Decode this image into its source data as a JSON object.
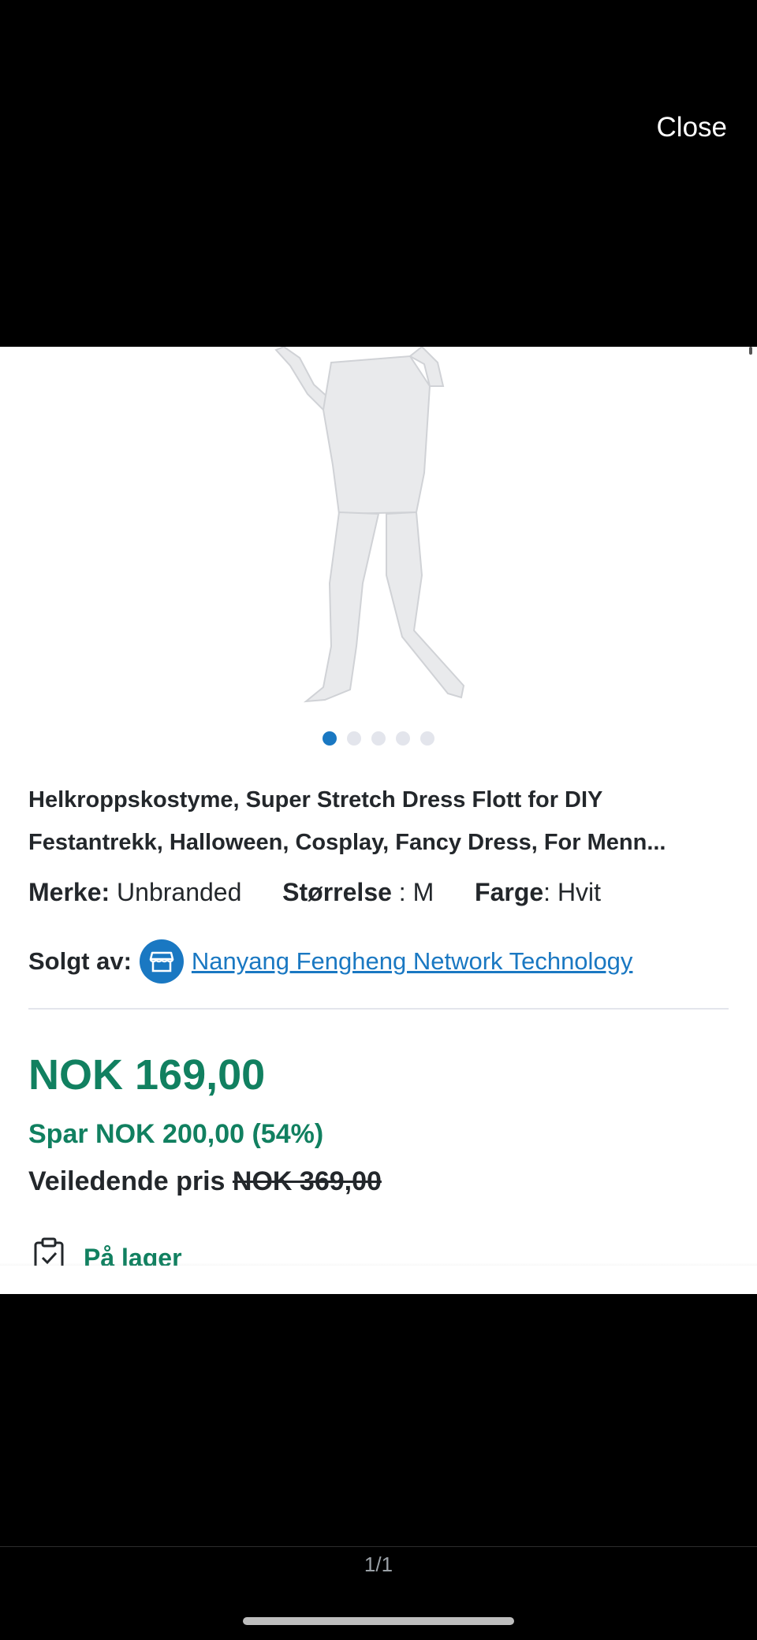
{
  "overlay": {
    "close_label": "Close",
    "page_counter": "1/1"
  },
  "product": {
    "image_alt": "white full body costume",
    "carousel": {
      "total": 5,
      "active": 1
    },
    "title": "Helkroppskostyme, Super Stretch Dress Flott for DIY Festantrekk, Halloween, Cosplay, Fancy Dress, For Menn...",
    "attributes": {
      "brand_label": "Merke:",
      "brand_value": "Unbranded",
      "size_label": "Størrelse",
      "size_sep": " : ",
      "size_value": "M",
      "color_label": "Farge",
      "color_sep": ": ",
      "color_value": "Hvit"
    },
    "seller": {
      "label": "Solgt av:",
      "name": "Nanyang Fengheng Network Technology"
    },
    "price": "NOK 169,00",
    "savings": "Spar NOK 200,00 (54%)",
    "rrp_label": "Veiledende pris",
    "rrp_value": "NOK 369,00",
    "stock": "På lager"
  },
  "colors": {
    "green": "#118060",
    "blue": "#1a78c2"
  }
}
